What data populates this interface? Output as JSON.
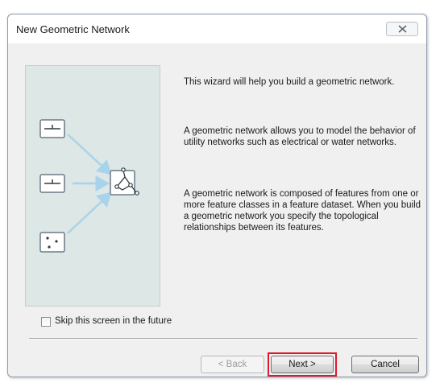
{
  "window": {
    "title": "New Geometric Network"
  },
  "description": {
    "paragraph_1": "This wizard will help you build a geometric network.",
    "paragraph_2": "A geometric network allows you to model the behavior of utility networks such as electrical or water networks.",
    "paragraph_3": "A geometric network is composed of features from one or more feature classes in a feature dataset. When you build a geometric network you specify the topological relationships between its features."
  },
  "options": {
    "skip_label": "Skip this screen in the future",
    "skip_checked": false
  },
  "buttons": {
    "back_label": "< Back",
    "back_enabled": false,
    "next_label": "Next >",
    "cancel_label": "Cancel"
  },
  "colors": {
    "illustration_background": "#dce7e6",
    "arrow": "#a9d3ea",
    "highlight": "#e0182c"
  },
  "icons": {
    "close": "close-icon",
    "line_feature_1": "line-feature-class-icon",
    "line_feature_2": "line-feature-class-icon",
    "point_feature": "point-feature-class-icon",
    "network": "geometric-network-icon"
  }
}
